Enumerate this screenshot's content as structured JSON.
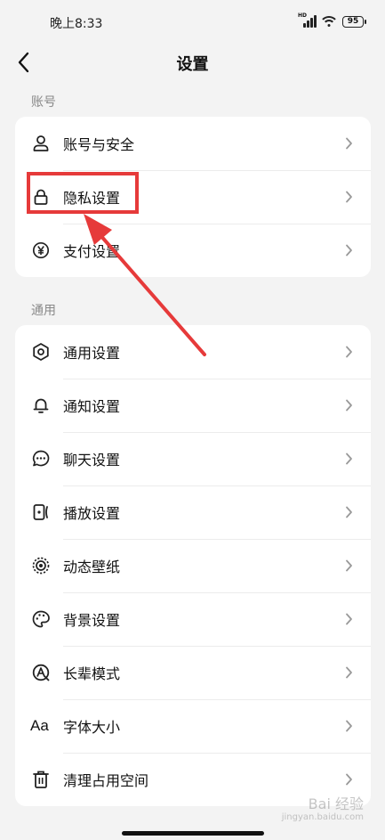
{
  "status_bar": {
    "time": "晚上8:33",
    "network": "HD",
    "battery": "95"
  },
  "nav": {
    "title": "设置"
  },
  "sections": {
    "account": {
      "label": "账号",
      "items": [
        {
          "label": "账号与安全",
          "icon": "user-icon"
        },
        {
          "label": "隐私设置",
          "icon": "lock-icon"
        },
        {
          "label": "支付设置",
          "icon": "yen-icon"
        }
      ]
    },
    "general": {
      "label": "通用",
      "items": [
        {
          "label": "通用设置",
          "icon": "gear-icon"
        },
        {
          "label": "通知设置",
          "icon": "bell-icon"
        },
        {
          "label": "聊天设置",
          "icon": "chat-bubble-icon"
        },
        {
          "label": "播放设置",
          "icon": "play-icon"
        },
        {
          "label": "动态壁纸",
          "icon": "live-wallpaper-icon"
        },
        {
          "label": "背景设置",
          "icon": "palette-icon"
        },
        {
          "label": "长辈模式",
          "icon": "elder-mode-icon"
        },
        {
          "label": "字体大小",
          "icon": "font-size-icon",
          "glyph": "Aa"
        },
        {
          "label": "清理占用空间",
          "icon": "trash-icon"
        }
      ]
    }
  },
  "watermark": {
    "brand": "Bai 经验",
    "url": "jingyan.baidu.com"
  },
  "colors": {
    "annotation": "#e63a3a",
    "background": "#f3f3f3",
    "card": "#ffffff"
  }
}
